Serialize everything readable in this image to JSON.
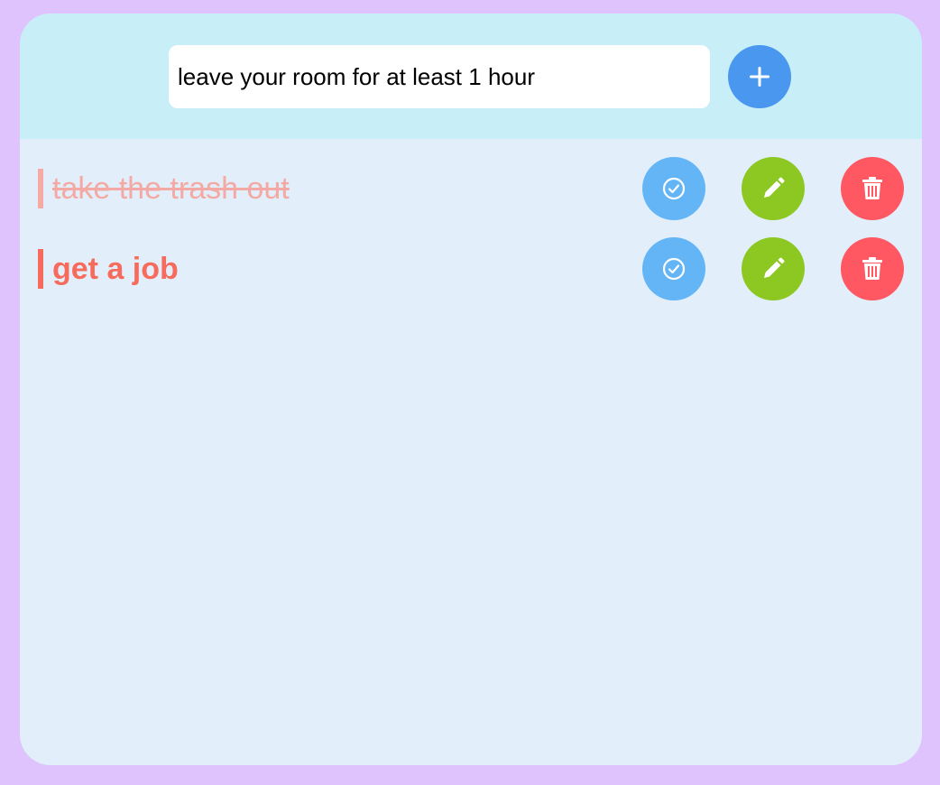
{
  "input": {
    "value": "leave your room for at least 1 hour",
    "placeholder": ""
  },
  "add_button": {
    "icon": "plus-icon"
  },
  "todos": [
    {
      "text": "take the trash out",
      "completed": true
    },
    {
      "text": "get a job",
      "completed": false
    }
  ],
  "colors": {
    "background": "#dfc3fc",
    "header": "#c8eef8",
    "list": "#e2effb",
    "add": "#4a97ef",
    "check": "#64b5f6",
    "edit": "#8cc722",
    "delete": "#ff5862",
    "todo_text": "#f76b5c",
    "todo_done_text": "#f4aaa4"
  },
  "icons": {
    "check": "check-circle-icon",
    "edit": "pencil-icon",
    "delete": "trash-icon"
  }
}
